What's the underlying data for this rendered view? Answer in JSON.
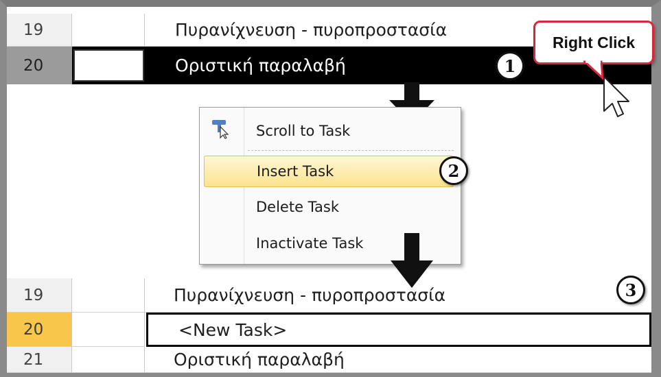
{
  "grid_before": {
    "rows": [
      {
        "id": "19",
        "name": "Πυρανίχνευση - πυροπροστασία"
      },
      {
        "id": "20",
        "name": "Οριστική παραλαβή"
      }
    ]
  },
  "grid_after": {
    "rows": [
      {
        "id": "19",
        "name": "Πυρανίχνευση - πυροπροστασία"
      },
      {
        "id": "20",
        "name": "<New Task>"
      },
      {
        "id": "21",
        "name": "Οριστική παραλαβή"
      }
    ]
  },
  "callout": {
    "text": "Right Click"
  },
  "steps": {
    "one": "1",
    "two": "2",
    "three": "3"
  },
  "context_menu": {
    "items": [
      {
        "label": "Scroll to Task",
        "icon": "scroll-to-task-icon"
      },
      {
        "label": "Insert Task",
        "highlighted": true
      },
      {
        "label": "Delete Task"
      },
      {
        "label": "Inactivate Task"
      }
    ]
  },
  "colors": {
    "selected_row_bg": "#000000",
    "new_task_row_number_bg": "#f7c64b",
    "menu_highlight": "#fbe38d",
    "callout_border": "#d6283a"
  }
}
